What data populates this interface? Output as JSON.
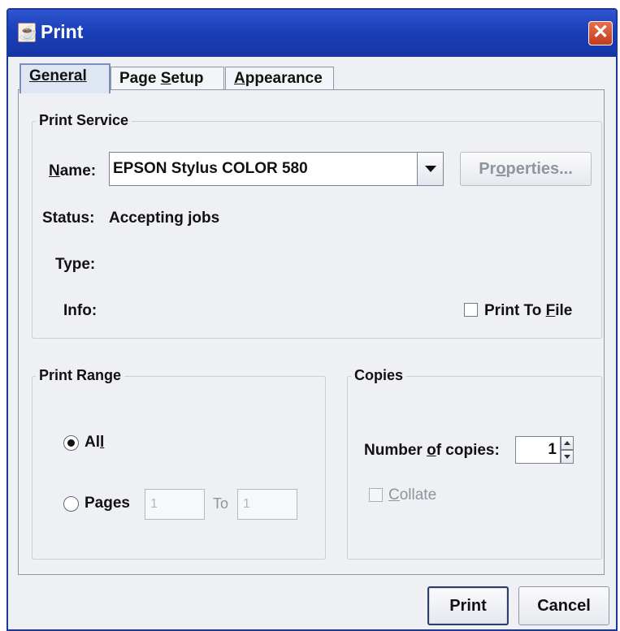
{
  "window": {
    "title": "Print",
    "close_label": "✕"
  },
  "tabs": [
    {
      "label": "General",
      "active": true
    },
    {
      "label_pre": "Page ",
      "label_u": "S",
      "label_post": "etup"
    },
    {
      "label_pre": "",
      "label_u": "A",
      "label_post": "ppearance"
    }
  ],
  "print_service": {
    "group_title": "Print Service",
    "name_label_u": "N",
    "name_label_rest": "ame:",
    "printer_name": "EPSON Stylus COLOR 580",
    "properties_pre": "Pr",
    "properties_u": "o",
    "properties_post": "perties...",
    "status_label": "Status:",
    "status_value": "Accepting jobs",
    "type_label": "Type:",
    "info_label": "Info:",
    "print_to_file_pre": "Print To ",
    "print_to_file_u": "F",
    "print_to_file_post": "ile"
  },
  "print_range": {
    "group_title": "Print Range",
    "all_pre": "Al",
    "all_u": "l",
    "pages_pre": "Pa",
    "pages_u": "g",
    "pages_post": "es",
    "from_value": "1",
    "to_label": "To",
    "to_value": "1"
  },
  "copies": {
    "group_title": "Copies",
    "number_pre": "Number ",
    "number_u": "o",
    "number_post": "f copies:",
    "number_value": "1",
    "collate_u": "C",
    "collate_post": "ollate"
  },
  "buttons": {
    "print": "Print",
    "cancel": "Cancel"
  }
}
